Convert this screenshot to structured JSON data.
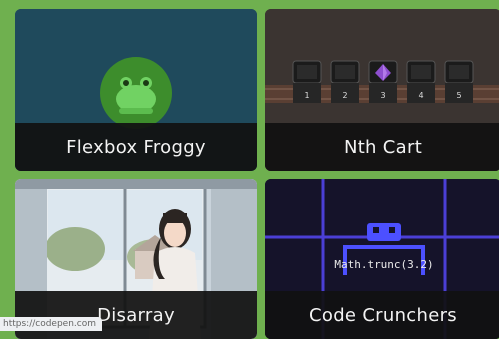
{
  "cards": [
    {
      "title": "Flexbox Froggy"
    },
    {
      "title": "Nth Cart",
      "cart_numbers": [
        "1",
        "2",
        "3",
        "4",
        "5"
      ]
    },
    {
      "title": "Disarray"
    },
    {
      "title": "Code Crunchers",
      "code_text": "Math.trunc(3.2)"
    }
  ],
  "status_bar": {
    "url": "https://codepen.com"
  },
  "colors": {
    "page_background": "#6fb04f",
    "banner": "#111111",
    "froggy_bg": "#1f4a5c",
    "cart_bg": "#3b3431",
    "code_bg": "#15132a",
    "code_grid": "#4b3fd6"
  }
}
